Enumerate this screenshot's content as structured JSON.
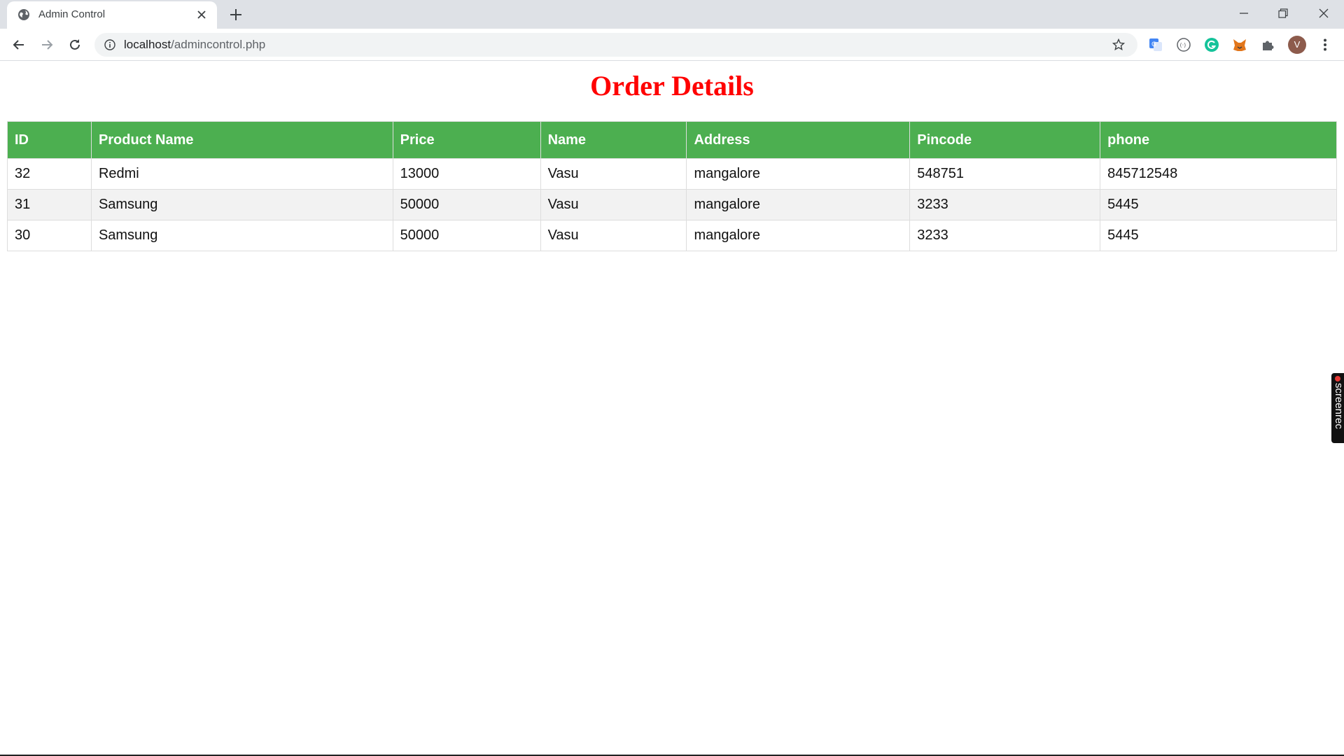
{
  "browser": {
    "tab_title": "Admin Control",
    "url_host": "localhost",
    "url_path": "/admincontrol.php",
    "avatar_initial": "V",
    "tab_bg": "#dee1e6"
  },
  "page": {
    "title": "Order Details",
    "title_color": "#ff0000",
    "header_color": "#4caf50"
  },
  "table": {
    "columns": [
      "ID",
      "Product Name",
      "Price",
      "Name",
      "Address",
      "Pincode",
      "phone"
    ],
    "rows": [
      [
        "32",
        "Redmi",
        "13000",
        "Vasu",
        "mangalore",
        "548751",
        "845712548"
      ],
      [
        "31",
        "Samsung",
        "50000",
        "Vasu",
        "mangalore",
        "3233",
        "5445"
      ],
      [
        "30",
        "Samsung",
        "50000",
        "Vasu",
        "mangalore",
        "3233",
        "5445"
      ]
    ]
  },
  "overlay": {
    "screenrec_label": "screenrec"
  }
}
